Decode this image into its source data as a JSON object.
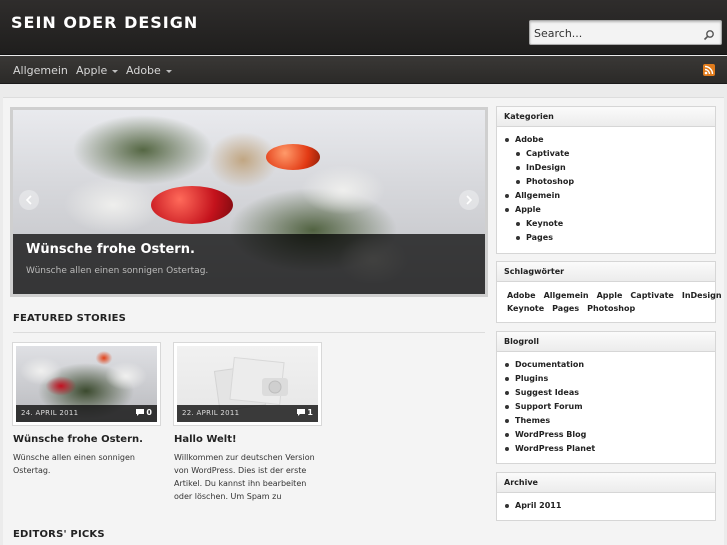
{
  "site": {
    "title": "SEIN ODER DESIGN"
  },
  "search": {
    "placeholder": "Search..."
  },
  "nav": {
    "items": [
      {
        "label": "Allgemein",
        "has_submenu": false
      },
      {
        "label": "Apple",
        "has_submenu": true
      },
      {
        "label": "Adobe",
        "has_submenu": true
      }
    ],
    "rss_icon": "rss-icon"
  },
  "slider": {
    "title": "Wünsche frohe Ostern.",
    "excerpt": "Wünsche allen einen sonnigen Ostertag."
  },
  "featured": {
    "heading": "FEATURED STORIES",
    "cards": [
      {
        "date": "24. APRIL 2011",
        "comments": "0",
        "title": "Wünsche frohe Ostern.",
        "excerpt": "Wünsche allen einen sonnigen Ostertag."
      },
      {
        "date": "22. APRIL 2011",
        "comments": "1",
        "title": "Hallo Welt!",
        "excerpt": "Willkommen zur deutschen Version von WordPress. Dies ist der erste Artikel. Du kannst ihn bearbeiten oder löschen. Um Spam zu vermeiden, geh doch gleich mal in den"
      }
    ]
  },
  "editors": {
    "heading": "EDITORS' PICKS"
  },
  "sidebar": {
    "categories": {
      "title": "Kategorien",
      "items": [
        {
          "label": "Adobe",
          "level": 0
        },
        {
          "label": "Captivate",
          "level": 1
        },
        {
          "label": "InDesign",
          "level": 1
        },
        {
          "label": "Photoshop",
          "level": 1
        },
        {
          "label": "Allgemein",
          "level": 0
        },
        {
          "label": "Apple",
          "level": 0
        },
        {
          "label": "Keynote",
          "level": 1
        },
        {
          "label": "Pages",
          "level": 1
        }
      ]
    },
    "tags": {
      "title": "Schlagwörter",
      "items": [
        "Adobe",
        "Allgemein",
        "Apple",
        "Captivate",
        "InDesign",
        "Keynote",
        "Pages",
        "Photoshop"
      ]
    },
    "blogroll": {
      "title": "Blogroll",
      "items": [
        "Documentation",
        "Plugins",
        "Suggest Ideas",
        "Support Forum",
        "Themes",
        "WordPress Blog",
        "WordPress Planet"
      ]
    },
    "archive": {
      "title": "Archive",
      "items": [
        "April 2011"
      ]
    }
  },
  "colors": {
    "header_bg": "#262524",
    "nav_bg": "#333130",
    "page_bg": "#f4f4f4",
    "rss": "#e07b1c"
  }
}
